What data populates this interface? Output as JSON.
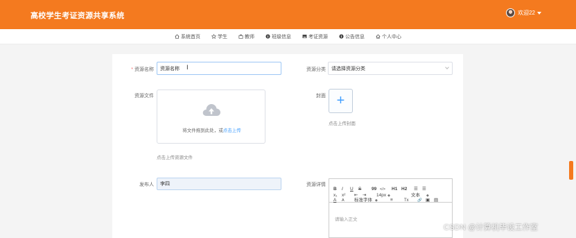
{
  "header": {
    "site_title": "高校学生考证资源共享系统",
    "user_name": "欢迎22",
    "accent_color": "#f47a1f"
  },
  "nav": {
    "items": [
      {
        "label": "系统首页",
        "icon": "home-icon"
      },
      {
        "label": "学生",
        "icon": "star-icon"
      },
      {
        "label": "教师",
        "icon": "bag-icon"
      },
      {
        "label": "班级信息",
        "icon": "info-circle-icon"
      },
      {
        "label": "考证资源",
        "icon": "image-icon"
      },
      {
        "label": "公告信息",
        "icon": "info-circle-icon"
      },
      {
        "label": "个人中心",
        "icon": "house-icon"
      }
    ]
  },
  "form": {
    "resource_name": {
      "label": "资源名称",
      "required_mark": "*",
      "value": "资源名称"
    },
    "resource_category": {
      "label": "资源分类",
      "placeholder": "请选择资源分类"
    },
    "resource_file": {
      "label": "资源文件",
      "drop_text": "将文件拖到此处，或",
      "click_text": "点击上传",
      "tip": "点击上传资源文件"
    },
    "cover": {
      "label": "封面",
      "tip": "点击上传封面"
    },
    "publisher": {
      "label": "发布人",
      "value": "李四"
    },
    "details": {
      "label": "资源详情",
      "placeholder": "请输入正文",
      "toolbar": {
        "bold": "B",
        "italic": "I",
        "underline": "U",
        "strike": "S",
        "quote": "99",
        "code": "</>",
        "h1": "H1",
        "h2": "H2",
        "ordered_list": "☰",
        "bullet_list": "☰",
        "subscript": "x₁",
        "superscript": "x²",
        "outdent": "⇤",
        "indent": "⇥",
        "font_size": "14px",
        "header_type": "文本",
        "font_color": "A",
        "background_color": "A",
        "font_family": "标准字体",
        "align": "≡",
        "clean": "Tx",
        "link": "🔗",
        "image": "▣",
        "video": "▤"
      }
    }
  },
  "watermark": "CSDN @计算机毕设工作室"
}
